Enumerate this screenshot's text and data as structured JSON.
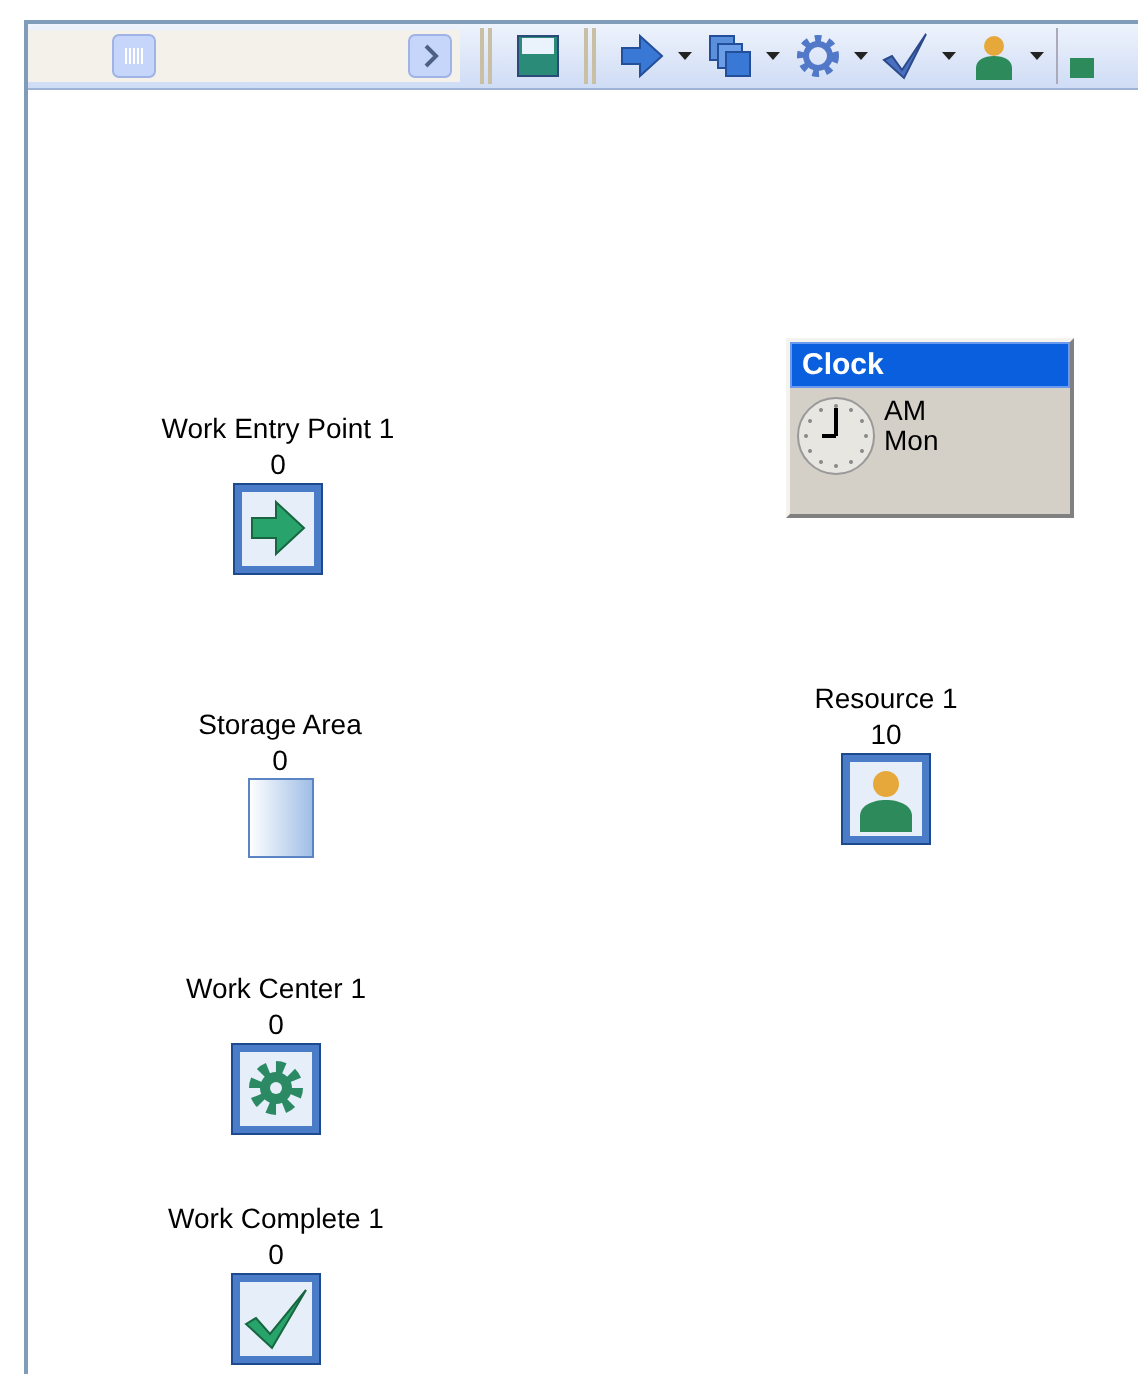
{
  "toolbar": {
    "buttons": [
      {
        "kind": "save",
        "dropdown": false
      },
      {
        "kind": "arrow",
        "dropdown": true
      },
      {
        "kind": "copy",
        "dropdown": true
      },
      {
        "kind": "gear",
        "dropdown": true
      },
      {
        "kind": "check",
        "dropdown": true
      },
      {
        "kind": "person",
        "dropdown": true
      }
    ]
  },
  "canvas": {
    "nodes": [
      {
        "kind": "entry",
        "label": "Work Entry Point 1",
        "count": "0"
      },
      {
        "kind": "storage",
        "label": "Storage Area",
        "count": "0"
      },
      {
        "kind": "center",
        "label": "Work Center 1",
        "count": "0"
      },
      {
        "kind": "complete",
        "label": "Work Complete 1",
        "count": "0"
      },
      {
        "kind": "resource",
        "label": "Resource 1",
        "count": "10"
      }
    ],
    "clock": {
      "title": "Clock",
      "period": "AM",
      "day": "Mon"
    }
  }
}
